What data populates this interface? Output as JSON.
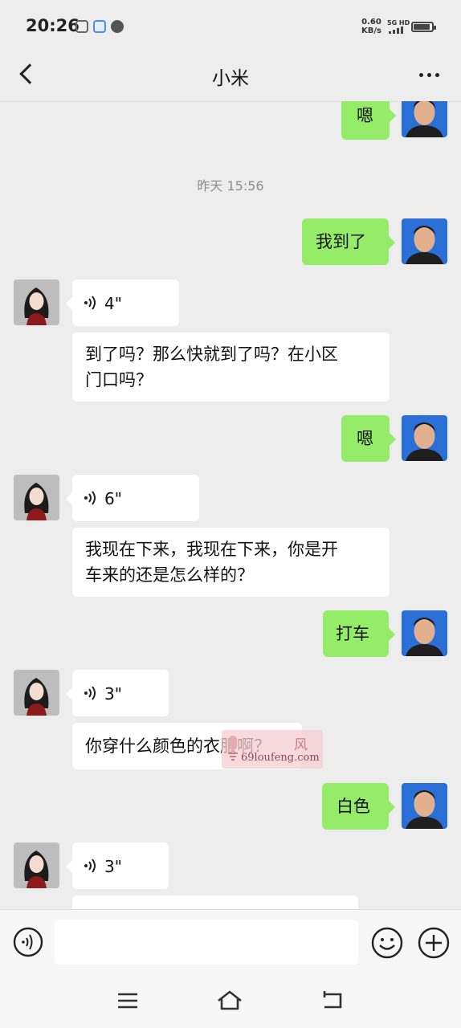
{
  "status_bar": {
    "time": "20:26",
    "net_speed_value": "0.60",
    "net_speed_unit": "KB/s",
    "network_type": "5G HD",
    "app_icons": [
      "baidu-icon",
      "browser-icon",
      "wechat-icon"
    ]
  },
  "header": {
    "title": "小米",
    "back_icon": "chevron-left-icon",
    "more_icon": "more-dots-icon"
  },
  "messages": [
    {
      "from": "me",
      "type": "text",
      "text": "嗯"
    },
    {
      "type": "timestamp",
      "text": "昨天 15:56"
    },
    {
      "from": "me",
      "type": "text",
      "text": "我到了"
    },
    {
      "from": "her",
      "type": "voice",
      "duration": "4\""
    },
    {
      "from": "her",
      "type": "text",
      "lines": [
        "到了吗？那么快就到了吗？在小区",
        "门口吗？"
      ]
    },
    {
      "from": "me",
      "type": "text",
      "text": "嗯"
    },
    {
      "from": "her",
      "type": "voice",
      "duration": "6\""
    },
    {
      "from": "her",
      "type": "text",
      "lines": [
        "我现在下来，我现在下来，你是开",
        "车来的还是怎么样的？"
      ]
    },
    {
      "from": "me",
      "type": "text",
      "text": "打车"
    },
    {
      "from": "her",
      "type": "voice",
      "duration": "3\""
    },
    {
      "from": "her",
      "type": "text",
      "text": "你穿什么颜色的衣服啊？"
    },
    {
      "from": "me",
      "type": "text",
      "text": "白色"
    },
    {
      "from": "her",
      "type": "voice",
      "duration": "3\""
    }
  ],
  "watermark": {
    "text": "69loufeng.com",
    "glyph": "风"
  },
  "input_bar": {
    "value": "",
    "placeholder": "",
    "voice_icon": "voice-input-icon",
    "emoji_icon": "emoji-icon",
    "add_icon": "plus-circle-icon"
  },
  "system_nav": {
    "icons": [
      "menu-icon",
      "home-icon",
      "back-icon"
    ]
  },
  "colors": {
    "background": "#ededed",
    "my_bubble": "#95ec69",
    "their_bubble": "#ffffff",
    "timestamp": "#8c8c8c"
  }
}
